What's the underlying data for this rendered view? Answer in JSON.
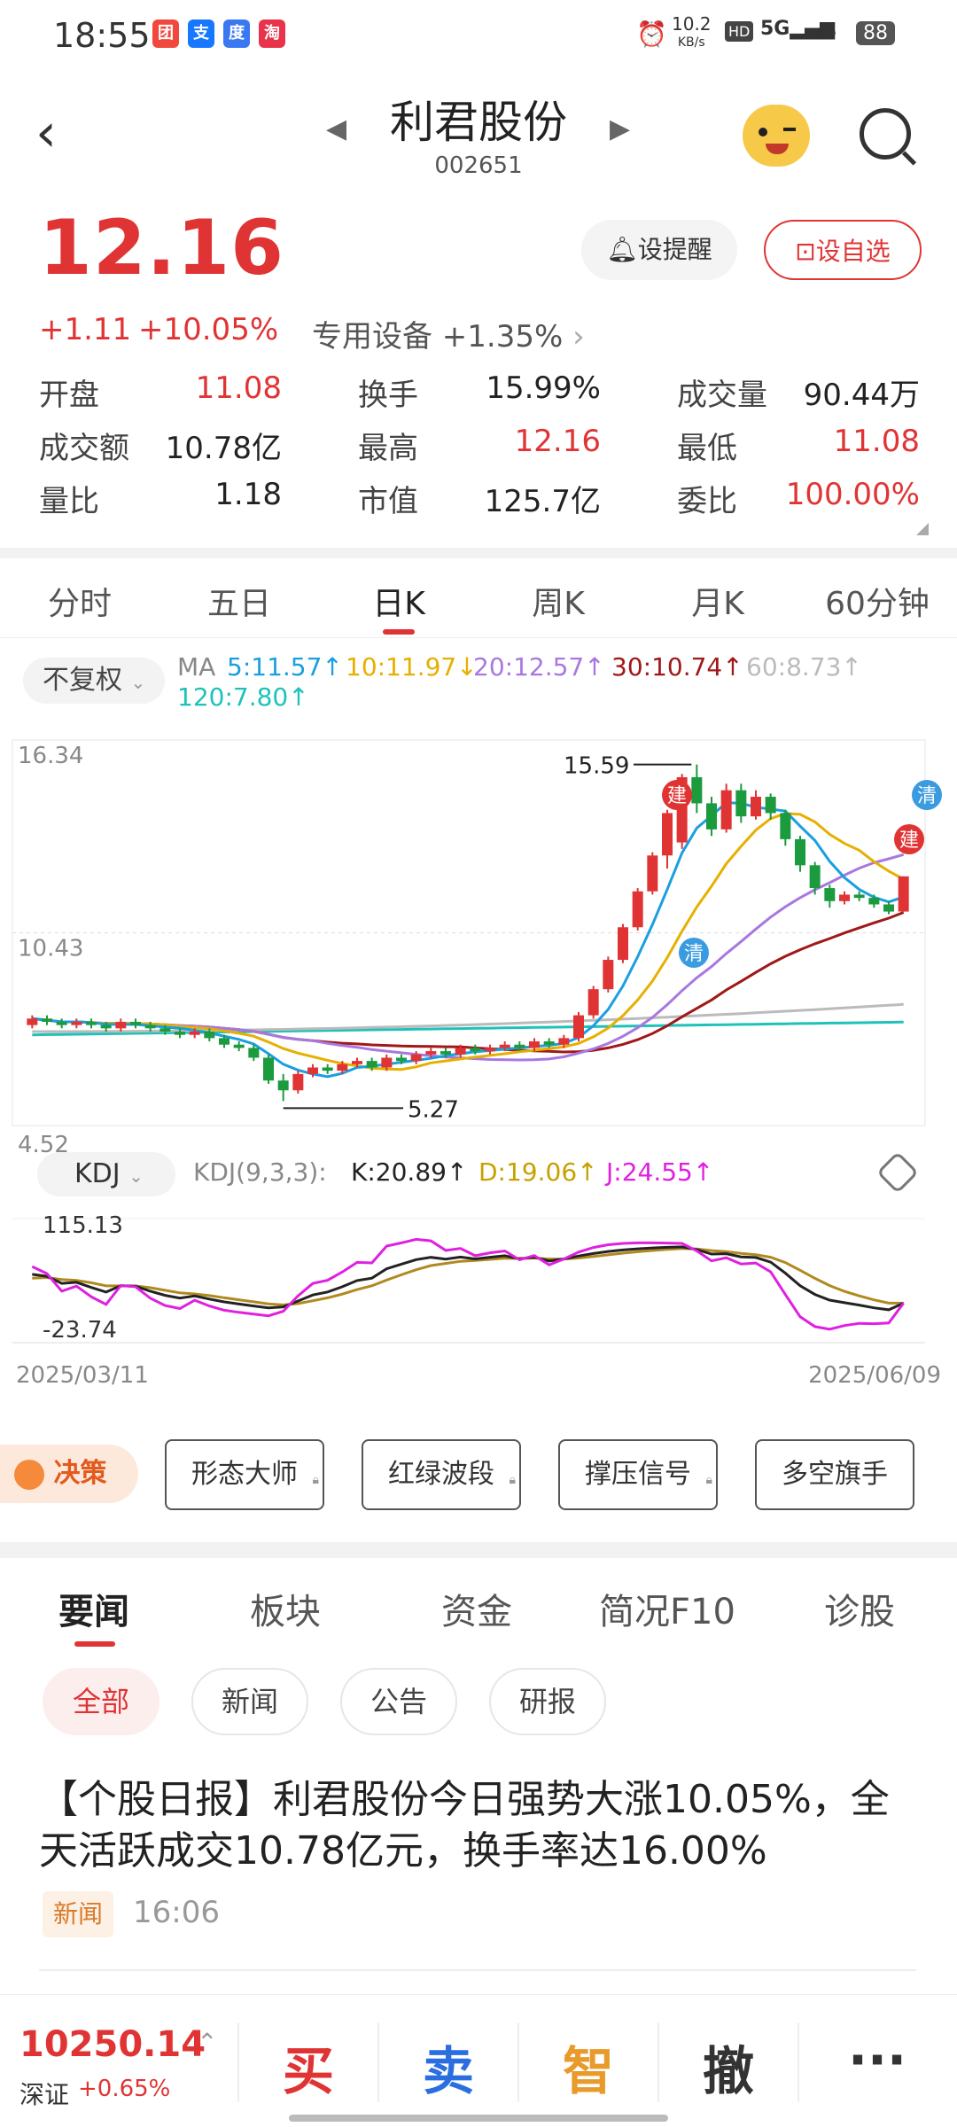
{
  "status_bar": {
    "time": "18:55",
    "net_speed_top": "10.2",
    "net_speed_bottom": "KB/s",
    "battery": "88"
  },
  "nav": {
    "title": "利君股份",
    "code": "002651"
  },
  "quote": {
    "price": "12.16",
    "change": "+1.11",
    "change_pct": "+10.05%",
    "sector": "专用设备 +1.35%",
    "alert_label": "设提醒",
    "watch_label": "设自选",
    "stats": [
      {
        "label": "开盘",
        "value": "11.08",
        "color": "red"
      },
      {
        "label": "换手",
        "value": "15.99%",
        "color": "black"
      },
      {
        "label": "成交量",
        "value": "90.44万",
        "color": "black"
      },
      {
        "label": "成交额",
        "value": "10.78亿",
        "color": "black"
      },
      {
        "label": "最高",
        "value": "12.16",
        "color": "red"
      },
      {
        "label": "最低",
        "value": "11.08",
        "color": "red"
      },
      {
        "label": "量比",
        "value": "1.18",
        "color": "black"
      },
      {
        "label": "市值",
        "value": "125.7亿",
        "color": "black"
      },
      {
        "label": "委比",
        "value": "100.00%",
        "color": "red"
      }
    ]
  },
  "k_tabs": [
    "分时",
    "五日",
    "日K",
    "周K",
    "月K",
    "60分钟"
  ],
  "k_tab_active": 2,
  "fuquan_label": "不复权",
  "ma_legend": [
    {
      "text": "MA",
      "color": "#888888"
    },
    {
      "text": "5:11.57↑",
      "color": "#1a9fe0"
    },
    {
      "text": "10:11.97↓",
      "color": "#e6b000"
    },
    {
      "text": "20:12.57↑",
      "color": "#a878e0"
    },
    {
      "text": "30:10.74↑",
      "color": "#a01818"
    },
    {
      "text": "60:8.73↑",
      "color": "#bbbbbb"
    },
    {
      "text": "120:7.80↑",
      "color": "#1ec2b8"
    }
  ],
  "chart_data": {
    "type": "candlestick",
    "y_axis_labels": [
      "16.34",
      "10.43",
      "4.52"
    ],
    "high_marker": "15.59",
    "low_marker": "5.27",
    "start_date": "2025/03/11",
    "end_date": "2025/06/09",
    "buy_marker": "建",
    "sell_marker": "清",
    "candles": [
      [
        7.6,
        7.8,
        7.5,
        7.9
      ],
      [
        7.8,
        7.7,
        7.6,
        7.9
      ],
      [
        7.7,
        7.6,
        7.5,
        7.8
      ],
      [
        7.6,
        7.7,
        7.5,
        7.8
      ],
      [
        7.7,
        7.6,
        7.5,
        7.8
      ],
      [
        7.6,
        7.5,
        7.4,
        7.7
      ],
      [
        7.5,
        7.7,
        7.4,
        7.8
      ],
      [
        7.7,
        7.6,
        7.5,
        7.8
      ],
      [
        7.6,
        7.5,
        7.4,
        7.7
      ],
      [
        7.5,
        7.4,
        7.3,
        7.6
      ],
      [
        7.4,
        7.3,
        7.2,
        7.5
      ],
      [
        7.3,
        7.4,
        7.2,
        7.5
      ],
      [
        7.4,
        7.2,
        7.1,
        7.5
      ],
      [
        7.2,
        7.0,
        6.9,
        7.3
      ],
      [
        7.0,
        6.9,
        6.8,
        7.1
      ],
      [
        6.9,
        6.6,
        6.5,
        7.0
      ],
      [
        6.6,
        5.9,
        5.8,
        6.7
      ],
      [
        5.9,
        5.6,
        5.27,
        6.1
      ],
      [
        5.6,
        6.1,
        5.5,
        6.2
      ],
      [
        6.1,
        6.3,
        6.0,
        6.4
      ],
      [
        6.3,
        6.2,
        6.1,
        6.4
      ],
      [
        6.2,
        6.4,
        6.1,
        6.5
      ],
      [
        6.4,
        6.5,
        6.3,
        6.6
      ],
      [
        6.5,
        6.3,
        6.2,
        6.6
      ],
      [
        6.3,
        6.6,
        6.2,
        6.7
      ],
      [
        6.6,
        6.5,
        6.4,
        6.7
      ],
      [
        6.5,
        6.7,
        6.4,
        6.8
      ],
      [
        6.7,
        6.8,
        6.6,
        6.9
      ],
      [
        6.8,
        6.7,
        6.6,
        6.9
      ],
      [
        6.7,
        6.9,
        6.6,
        7.0
      ],
      [
        6.9,
        6.8,
        6.7,
        7.0
      ],
      [
        6.8,
        6.9,
        6.7,
        7.0
      ],
      [
        6.9,
        7.0,
        6.8,
        7.1
      ],
      [
        7.0,
        6.9,
        6.8,
        7.1
      ],
      [
        6.9,
        7.1,
        6.8,
        7.2
      ],
      [
        7.1,
        7.0,
        6.9,
        7.2
      ],
      [
        7.0,
        7.2,
        6.9,
        7.3
      ],
      [
        7.2,
        7.9,
        7.1,
        8.0
      ],
      [
        7.9,
        8.7,
        7.8,
        8.8
      ],
      [
        8.7,
        9.6,
        8.6,
        9.7
      ],
      [
        9.6,
        10.6,
        9.5,
        10.7
      ],
      [
        10.6,
        11.7,
        10.5,
        11.8
      ],
      [
        11.7,
        12.8,
        11.6,
        12.9
      ],
      [
        12.8,
        14.1,
        12.4,
        14.2
      ],
      [
        13.2,
        15.2,
        13.0,
        15.3
      ],
      [
        15.2,
        14.4,
        14.1,
        15.59
      ],
      [
        14.4,
        13.6,
        13.4,
        14.6
      ],
      [
        13.6,
        14.8,
        13.5,
        15.0
      ],
      [
        14.8,
        14.0,
        13.8,
        15.0
      ],
      [
        14.0,
        14.6,
        13.9,
        14.8
      ],
      [
        14.6,
        14.1,
        13.9,
        14.7
      ],
      [
        14.1,
        13.3,
        13.1,
        14.2
      ],
      [
        13.3,
        12.5,
        12.3,
        13.4
      ],
      [
        12.5,
        11.8,
        11.6,
        12.6
      ],
      [
        11.8,
        11.4,
        11.2,
        11.9
      ],
      [
        11.4,
        11.6,
        11.3,
        11.7
      ],
      [
        11.6,
        11.5,
        11.4,
        11.7
      ],
      [
        11.5,
        11.3,
        11.2,
        11.6
      ],
      [
        11.3,
        11.08,
        11.0,
        11.4
      ],
      [
        11.08,
        12.16,
        11.08,
        12.16
      ]
    ]
  },
  "kdj": {
    "btn_label": "KDJ",
    "params": "KDJ(9,3,3):",
    "k": "K:20.89↑",
    "d": "D:19.06↑",
    "j": "J:24.55↑",
    "top": "115.13",
    "bottom": "-23.74"
  },
  "decision": {
    "label": "决策",
    "tools": [
      "形态大师",
      "红绿波段",
      "撑压信号",
      "多空旗手"
    ]
  },
  "news_tabs": [
    "要闻",
    "板块",
    "资金",
    "简况F10",
    "诊股"
  ],
  "filters": [
    "全部",
    "新闻",
    "公告",
    "研报"
  ],
  "news": {
    "headline": "【个股日报】利君股份今日强势大涨10.05%，全天活跃成交10.78亿元，换手率达16.00%",
    "tag": "新闻",
    "time": "16:06"
  },
  "bottom": {
    "index_value": "10250.14",
    "index_name": "深证",
    "index_change": "+0.65%",
    "buy": "买",
    "sell": "卖",
    "smart": "智",
    "cancel": "撤",
    "more": "···"
  }
}
